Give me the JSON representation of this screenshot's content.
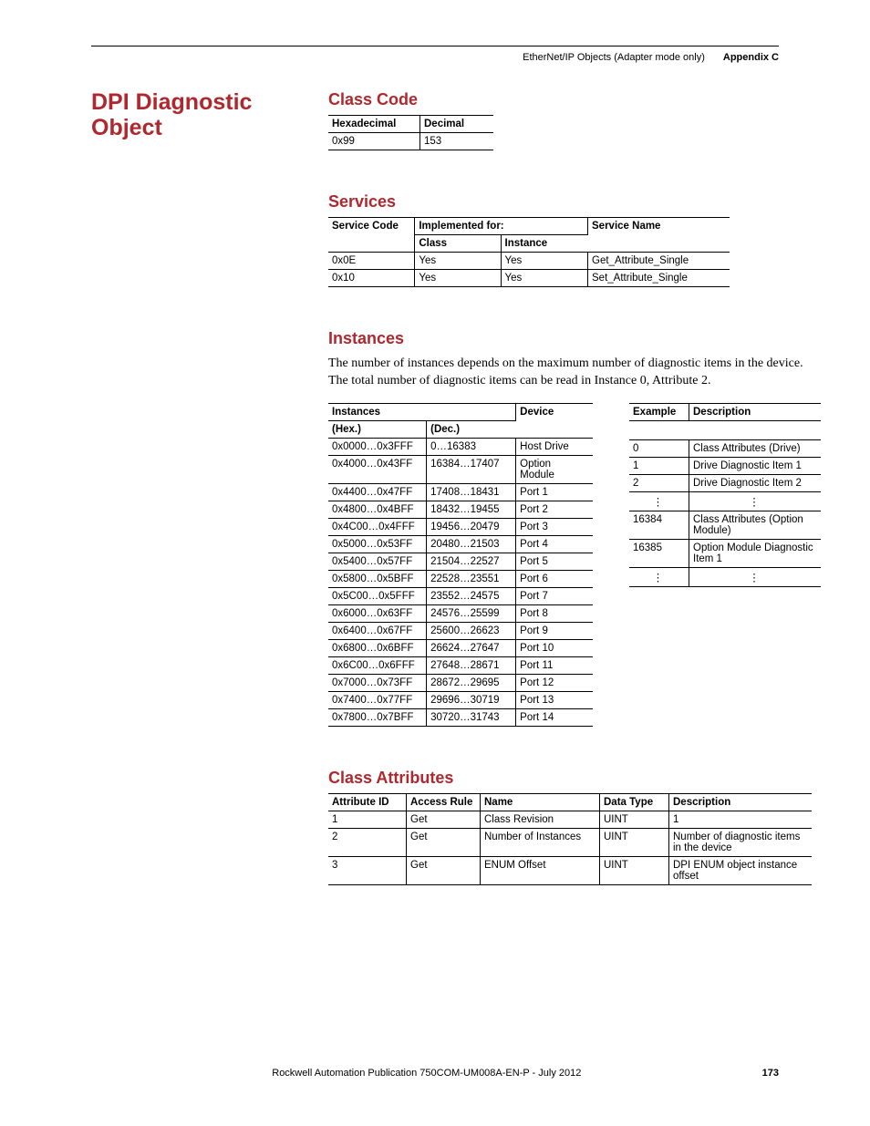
{
  "header": {
    "book_section": "EtherNet/IP Objects (Adapter mode only)",
    "appendix": "Appendix C"
  },
  "title": "DPI Diagnostic Object",
  "class_code": {
    "heading": "Class Code",
    "cols": [
      "Hexadecimal",
      "Decimal"
    ],
    "row": [
      "0x99",
      "153"
    ]
  },
  "services": {
    "heading": "Services",
    "cols": {
      "code": "Service Code",
      "impl": "Implemented for:",
      "class": "Class",
      "instance": "Instance",
      "name": "Service Name"
    },
    "rows": [
      {
        "code": "0x0E",
        "class": "Yes",
        "instance": "Yes",
        "name": "Get_Attribute_Single"
      },
      {
        "code": "0x10",
        "class": "Yes",
        "instance": "Yes",
        "name": "Set_Attribute_Single"
      }
    ]
  },
  "instances": {
    "heading": "Instances",
    "intro": "The number of instances depends on the maximum number of diagnostic items in the device. The total number of diagnostic items can be read in Instance 0, Attribute 2.",
    "cols": {
      "inst": "Instances",
      "hex": "(Hex.)",
      "dec": "(Dec.)",
      "device": "Device"
    },
    "rows": [
      {
        "hex": "0x0000…0x3FFF",
        "dec": "0…16383",
        "device": "Host Drive"
      },
      {
        "hex": "0x4000…0x43FF",
        "dec": "16384…17407",
        "device": "Option Module"
      },
      {
        "hex": "0x4400…0x47FF",
        "dec": "17408…18431",
        "device": "Port 1"
      },
      {
        "hex": "0x4800…0x4BFF",
        "dec": "18432…19455",
        "device": "Port 2"
      },
      {
        "hex": "0x4C00…0x4FFF",
        "dec": "19456…20479",
        "device": "Port 3"
      },
      {
        "hex": "0x5000…0x53FF",
        "dec": "20480…21503",
        "device": "Port 4"
      },
      {
        "hex": "0x5400…0x57FF",
        "dec": "21504…22527",
        "device": "Port 5"
      },
      {
        "hex": "0x5800…0x5BFF",
        "dec": "22528…23551",
        "device": "Port 6"
      },
      {
        "hex": "0x5C00…0x5FFF",
        "dec": "23552…24575",
        "device": "Port 7"
      },
      {
        "hex": "0x6000…0x63FF",
        "dec": "24576…25599",
        "device": "Port 8"
      },
      {
        "hex": "0x6400…0x67FF",
        "dec": "25600…26623",
        "device": "Port 9"
      },
      {
        "hex": "0x6800…0x6BFF",
        "dec": "26624…27647",
        "device": "Port 10"
      },
      {
        "hex": "0x6C00…0x6FFF",
        "dec": "27648…28671",
        "device": "Port 11"
      },
      {
        "hex": "0x7000…0x73FF",
        "dec": "28672…29695",
        "device": "Port 12"
      },
      {
        "hex": "0x7400…0x77FF",
        "dec": "29696…30719",
        "device": "Port 13"
      },
      {
        "hex": "0x7800…0x7BFF",
        "dec": "30720…31743",
        "device": "Port 14"
      }
    ]
  },
  "examples": {
    "cols": {
      "ex": "Example",
      "desc": "Description"
    },
    "rows": [
      {
        "ex": "0",
        "desc": "Class Attributes (Drive)"
      },
      {
        "ex": "1",
        "desc": "Drive Diagnostic Item 1"
      },
      {
        "ex": "2",
        "desc": "Drive Diagnostic Item 2"
      },
      {
        "ex": "⋮",
        "desc": "⋮",
        "vdots": true
      },
      {
        "ex": "16384",
        "desc": "Class Attributes (Option Module)"
      },
      {
        "ex": "16385",
        "desc": "Option Module Diagnostic Item 1"
      },
      {
        "ex": "⋮",
        "desc": "⋮",
        "vdots": true
      }
    ]
  },
  "class_attributes": {
    "heading": "Class Attributes",
    "cols": {
      "id": "Attribute ID",
      "rule": "Access Rule",
      "name": "Name",
      "type": "Data Type",
      "desc": "Description"
    },
    "rows": [
      {
        "id": "1",
        "rule": "Get",
        "name": "Class Revision",
        "type": "UINT",
        "desc": "1"
      },
      {
        "id": "2",
        "rule": "Get",
        "name": "Number of Instances",
        "type": "UINT",
        "desc": "Number of diagnostic items in the device"
      },
      {
        "id": "3",
        "rule": "Get",
        "name": "ENUM Offset",
        "type": "UINT",
        "desc": "DPI ENUM object instance offset"
      }
    ]
  },
  "footer": {
    "pub": "Rockwell Automation Publication 750COM-UM008A-EN-P - July 2012",
    "page": "173"
  }
}
